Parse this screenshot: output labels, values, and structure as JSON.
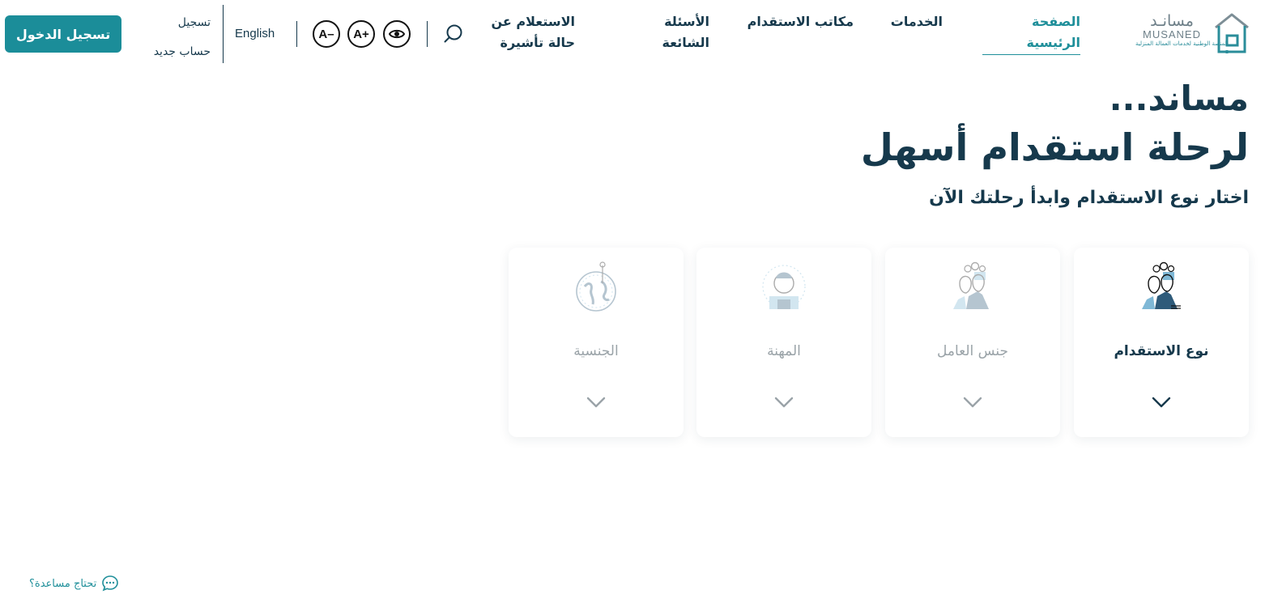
{
  "brand": {
    "name_ar": "مسانـد",
    "name_en": "MUSANED",
    "tagline": "المنصة الوطنية لخدمات العمالة المنزلية"
  },
  "nav": {
    "home": "الصفحة الرئيسية",
    "services": "الخدمات",
    "offices": "مكاتب الاستقدام",
    "faq": "الأسئلة الشائعة",
    "visa_inquiry": "الاستعلام عن حالة تأشيرة"
  },
  "toolbar": {
    "search_icon": "search-icon",
    "eye_icon": "eye-icon",
    "increase_font": "A+",
    "decrease_font": "A–",
    "language": "English",
    "register_line1": "تسجيل",
    "register_line2": "حساب جديد",
    "login": "تسجيل الدخول"
  },
  "hero": {
    "line1": "مساند...",
    "line2": "لرحلة استقدام أسهل",
    "subtitle": "اختار نوع الاستقدام وابدأ رحلتك الآن"
  },
  "steps": [
    {
      "label": "نوع الاستقدام",
      "state": "active",
      "icon": "recruitment-type-icon"
    },
    {
      "label": "جنس العامل",
      "state": "disabled",
      "icon": "worker-gender-icon"
    },
    {
      "label": "المهنة",
      "state": "disabled",
      "icon": "profession-icon"
    },
    {
      "label": "الجنسية",
      "state": "disabled",
      "icon": "nationality-icon"
    }
  ],
  "help": {
    "label": "تحتاج مساعدة؟"
  },
  "colors": {
    "primary": "#1b8d99",
    "navy": "#16394c",
    "muted": "#9aa3a8",
    "accent_blue": "#7fb8d6"
  }
}
